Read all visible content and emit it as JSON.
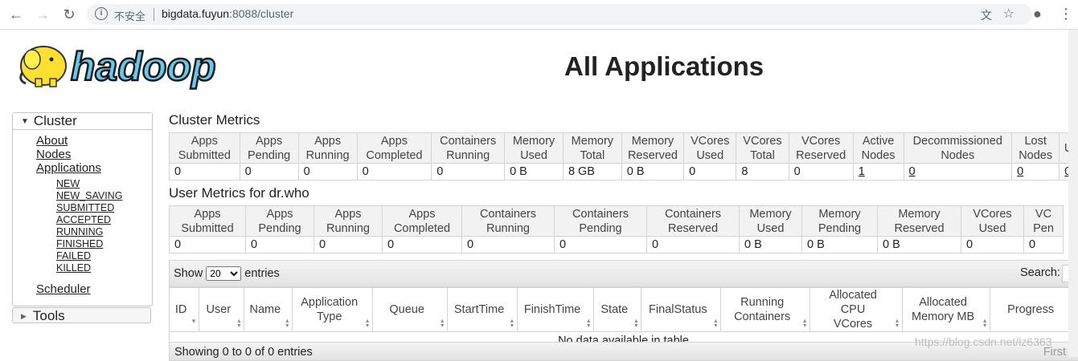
{
  "browser": {
    "security_label": "不安全",
    "url_host": "bigdata.fuyun",
    "url_rest": ":8088/cluster"
  },
  "header": {
    "logo_text": "hadoop",
    "title": "All Applications"
  },
  "sidebar": {
    "cluster_label": "Cluster",
    "items": [
      {
        "label": "About"
      },
      {
        "label": "Nodes"
      },
      {
        "label": "Applications"
      }
    ],
    "app_states": [
      "NEW",
      "NEW_SAVING",
      "SUBMITTED",
      "ACCEPTED",
      "RUNNING",
      "FINISHED",
      "FAILED",
      "KILLED"
    ],
    "scheduler_label": "Scheduler",
    "tools_label": "Tools"
  },
  "cluster_metrics": {
    "title": "Cluster Metrics",
    "headers": [
      [
        "Apps",
        "Submitted"
      ],
      [
        "Apps",
        "Pending"
      ],
      [
        "Apps",
        "Running"
      ],
      [
        "Apps",
        "Completed"
      ],
      [
        "Containers",
        "Running"
      ],
      [
        "Memory",
        "Used"
      ],
      [
        "Memory",
        "Total"
      ],
      [
        "Memory",
        "Reserved"
      ],
      [
        "VCores",
        "Used"
      ],
      [
        "VCores",
        "Total"
      ],
      [
        "VCores",
        "Reserved"
      ],
      [
        "Active",
        "Nodes"
      ],
      [
        "Decommissioned",
        "Nodes"
      ],
      [
        "Lost",
        "Nodes"
      ],
      [
        "U",
        ""
      ]
    ],
    "values": [
      "0",
      "0",
      "0",
      "0",
      "0",
      "0 B",
      "8 GB",
      "0 B",
      "0",
      "8",
      "0",
      "1",
      "0",
      "0",
      "0"
    ]
  },
  "user_metrics": {
    "title": "User Metrics for dr.who",
    "headers": [
      [
        "Apps",
        "Submitted"
      ],
      [
        "Apps",
        "Pending"
      ],
      [
        "Apps",
        "Running"
      ],
      [
        "Apps",
        "Completed"
      ],
      [
        "Containers",
        "Running"
      ],
      [
        "Containers",
        "Pending"
      ],
      [
        "Containers",
        "Reserved"
      ],
      [
        "Memory",
        "Used"
      ],
      [
        "Memory",
        "Pending"
      ],
      [
        "Memory",
        "Reserved"
      ],
      [
        "VCores",
        "Used"
      ],
      [
        "VC",
        "Pen"
      ]
    ],
    "values": [
      "0",
      "0",
      "0",
      "0",
      "0",
      "0",
      "0",
      "0 B",
      "0 B",
      "0 B",
      "0",
      "0"
    ]
  },
  "apps_table": {
    "show_label": "Show",
    "entries_value": "20",
    "entries_label": "entries",
    "search_label": "Search:",
    "columns": [
      [
        "ID",
        ""
      ],
      [
        "User",
        ""
      ],
      [
        "Name",
        ""
      ],
      [
        "Application",
        "Type"
      ],
      [
        "Queue",
        ""
      ],
      [
        "StartTime",
        ""
      ],
      [
        "FinishTime",
        ""
      ],
      [
        "State",
        ""
      ],
      [
        "FinalStatus",
        ""
      ],
      [
        "Running",
        "Containers"
      ],
      [
        "Allocated CPU",
        "VCores"
      ],
      [
        "Allocated",
        "Memory MB"
      ],
      [
        "Progress",
        ""
      ]
    ],
    "empty_message": "No data available in table",
    "info": "Showing 0 to 0 of 0 entries",
    "first_label": "First"
  },
  "watermark": "https://blog.csdn.net/lz6363"
}
